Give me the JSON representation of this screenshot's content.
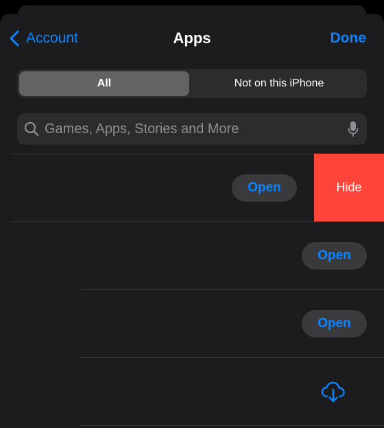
{
  "nav": {
    "back_label": "Account",
    "title": "Apps",
    "done_label": "Done"
  },
  "segments": {
    "all_label": "All",
    "not_on_device_label": "Not on this iPhone",
    "selected": "All"
  },
  "search": {
    "placeholder": "Games, Apps, Stories and More",
    "value": ""
  },
  "rows": [
    {
      "action": "Open",
      "swipe_action": "Hide",
      "swiped": true
    },
    {
      "action": "Open"
    },
    {
      "action": "Open"
    },
    {
      "action": "download",
      "icon": "cloud-download-icon"
    }
  ],
  "colors": {
    "accent": "#0a84ff",
    "destructive": "#ff453a",
    "background": "#1c1c1e",
    "control": "#2c2c2e"
  }
}
